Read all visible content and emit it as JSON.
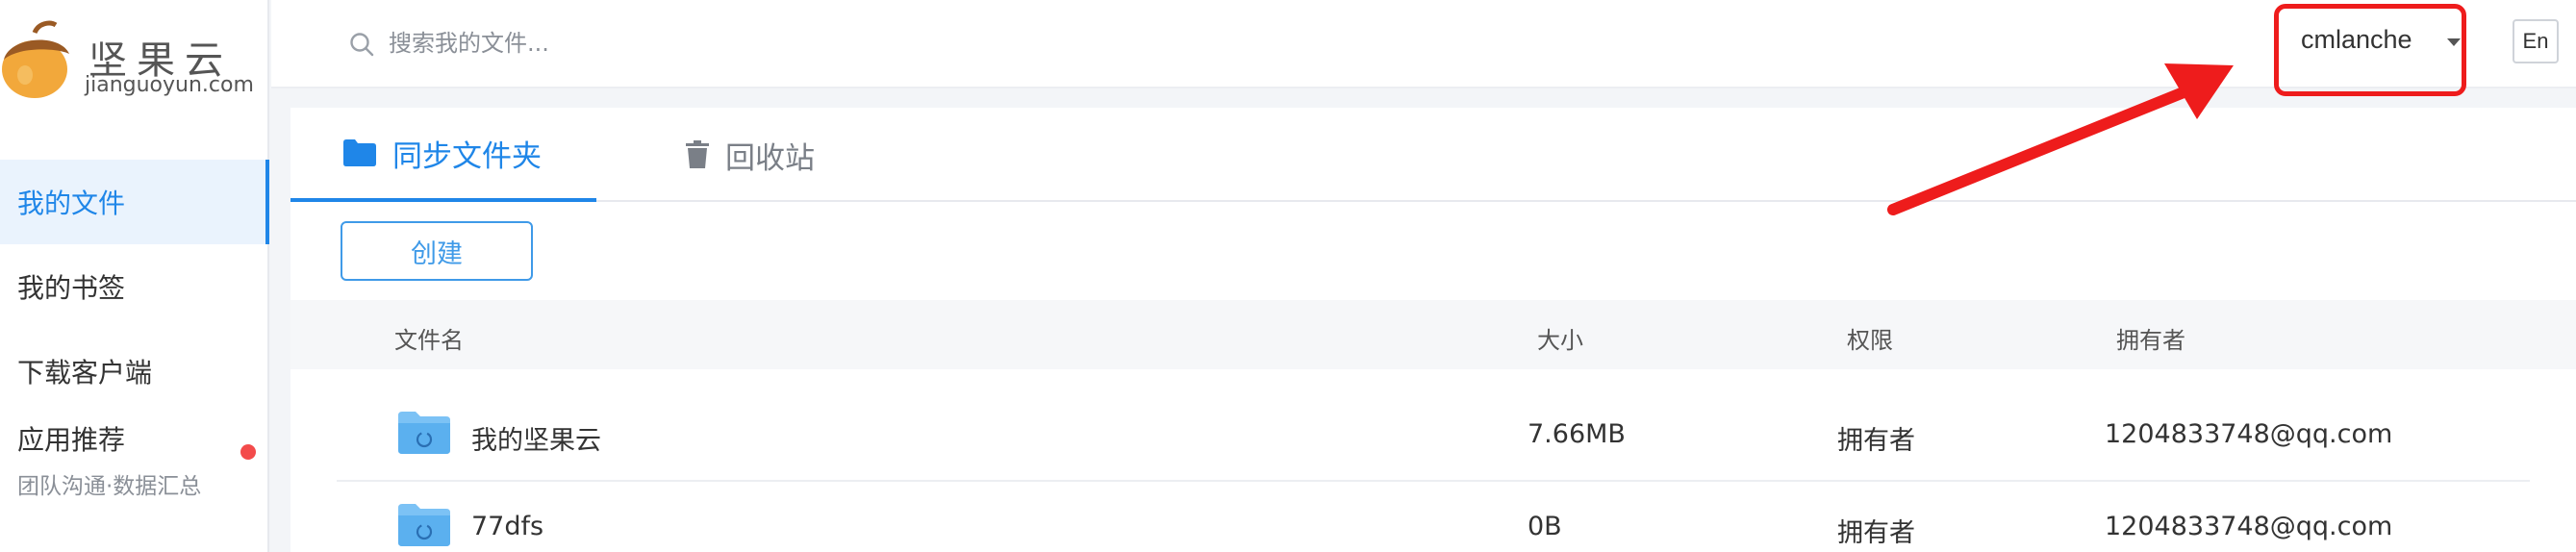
{
  "brand": {
    "title": "坚果云",
    "subtitle": "jianguoyun.com",
    "accent": "#1f86e8"
  },
  "sidebar": {
    "items": [
      {
        "label": "我的文件",
        "active": true
      },
      {
        "label": "我的书签",
        "active": false
      },
      {
        "label": "下载客户端",
        "active": false
      }
    ],
    "app": {
      "title": "应用推荐",
      "subtitle": "团队沟通·数据汇总",
      "badge_color": "#f34b4b"
    }
  },
  "topbar": {
    "search_placeholder": "搜索我的文件...",
    "search_value": "",
    "username": "cmlanche",
    "lang_label": "En",
    "highlight_color": "#ee1c1c"
  },
  "tabs": [
    {
      "label": "同步文件夹",
      "icon": "folder-icon",
      "active": true
    },
    {
      "label": "回收站",
      "icon": "trash-icon",
      "active": false
    }
  ],
  "toolbar": {
    "create_label": "创建"
  },
  "table": {
    "columns": [
      "文件名",
      "大小",
      "权限",
      "拥有者"
    ],
    "rows": [
      {
        "name": "我的坚果云",
        "size": "7.66MB",
        "permission": "拥有者",
        "owner": "1204833748@qq.com"
      },
      {
        "name": "77dfs",
        "size": "0B",
        "permission": "拥有者",
        "owner": "1204833748@qq.com"
      }
    ]
  }
}
